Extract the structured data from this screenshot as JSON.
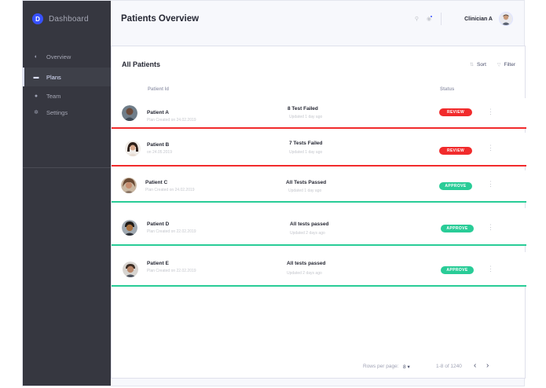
{
  "colors": {
    "sidebar_bg": "#363740",
    "accent": "#3751ff",
    "review": "#f12b2c",
    "approve": "#29cc97"
  },
  "sidebar": {
    "brand_title": "Dashboard",
    "brand_logo_letter": "D",
    "items": [
      {
        "label": "Overview",
        "icon": "pie-chart-icon"
      },
      {
        "label": "Plans",
        "icon": "ticket-icon"
      },
      {
        "label": "Team",
        "icon": "person-icon"
      },
      {
        "label": "Settings",
        "icon": "gear-icon"
      }
    ],
    "active_item": "Plans"
  },
  "header": {
    "title": "Patients Overview",
    "user_name": "Clinician A"
  },
  "table": {
    "title": "All Patients",
    "sort_label": "Sort",
    "filter_label": "Filter",
    "columns": {
      "patient": "Patient Id",
      "status": "Status"
    },
    "rows": [
      {
        "name": "Patient A",
        "sub": "Plan Created on 24.02.2019",
        "tests": "8 Test Failed",
        "updated": "Updated 1 day ago",
        "status": "REVIEW",
        "status_color": "#f12b2c"
      },
      {
        "name": "Patient B",
        "sub": "on 24.05.2019",
        "tests": "7 Tests Failed",
        "updated": "Updated 1 day ago",
        "status": "REVIEW",
        "status_color": "#f12b2c"
      },
      {
        "name": "Patient C",
        "sub": "Plan Created on 24.02.2019",
        "tests": "All Tests Passed",
        "updated": "Updated 1 day ago",
        "status": "APPROVE",
        "status_color": "#29cc97"
      },
      {
        "name": "Patient D",
        "sub": "Plan Created on 22.02.2019",
        "tests": "All tests passed",
        "updated": "Updated 2 days ago",
        "status": "APPROVE",
        "status_color": "#29cc97"
      },
      {
        "name": "Patient E",
        "sub": "Plan Created on 22.02.2019",
        "tests": "All tests passed",
        "updated": "Updated 2 days ago",
        "status": "APPROVE",
        "status_color": "#29cc97"
      }
    ],
    "footer": {
      "rows_per_page_label": "Rows per page:",
      "rows_per_page_value": "8",
      "range": "1-8 of 1240"
    }
  }
}
